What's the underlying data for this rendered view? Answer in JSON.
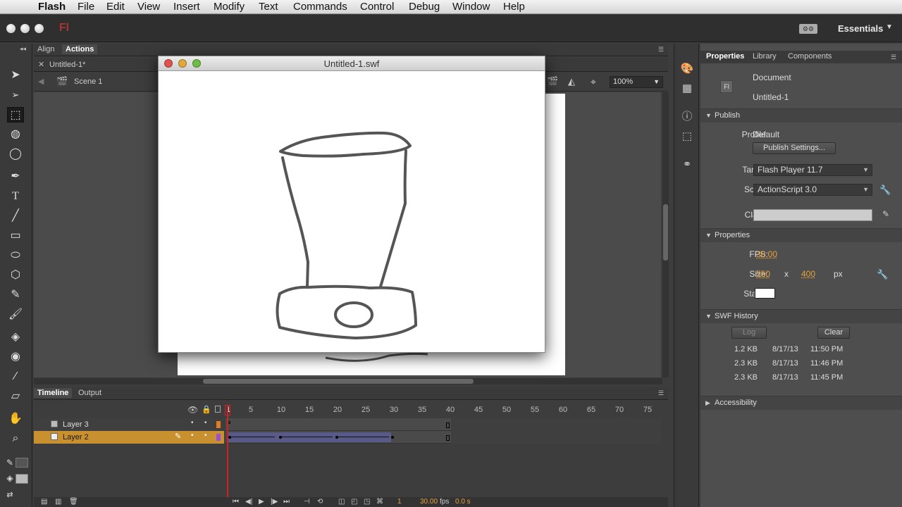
{
  "menubar": {
    "items": [
      "Flash",
      "File",
      "Edit",
      "View",
      "Insert",
      "Modify",
      "Text",
      "Commands",
      "Control",
      "Debug",
      "Window",
      "Help"
    ]
  },
  "appbar": {
    "app_icon_label": "Fl",
    "workspace": "Essentials"
  },
  "left_panel": {
    "tabs": [
      "Align",
      "Actions"
    ],
    "doc_tab": "Untitled-1*",
    "scene": "Scene 1",
    "zoom": "100%"
  },
  "swf_window": {
    "title": "Untitled-1.swf"
  },
  "timeline": {
    "tabs": [
      "Timeline",
      "Output"
    ],
    "ruler": [
      "1",
      "5",
      "10",
      "15",
      "20",
      "25",
      "30",
      "35",
      "40",
      "45",
      "50",
      "55",
      "60",
      "65",
      "70",
      "75"
    ],
    "layers": [
      {
        "name": "Layer 3"
      },
      {
        "name": "Layer 2"
      }
    ],
    "current_frame": "1",
    "fps": "30.00",
    "fps_unit": "fps",
    "time": "0.0 s"
  },
  "properties": {
    "tabs": [
      "Properties",
      "Library",
      "Components"
    ],
    "doc_icon": "Fl",
    "doc_type": "Document",
    "doc_name": "Untitled-1",
    "publish": {
      "title": "Publish",
      "profile_label": "Profile:",
      "profile_value": "Default",
      "settings_button": "Publish Settings...",
      "target_label": "Target:",
      "target_value": "Flash Player 11.7",
      "script_label": "Script:",
      "script_value": "ActionScript 3.0",
      "class_label": "Class:",
      "class_value": ""
    },
    "props": {
      "title": "Properties",
      "fps_label": "FPS:",
      "fps_value": "30.00",
      "size_label": "Size:",
      "width": "550",
      "x": "x",
      "height": "400",
      "unit": "px",
      "stage_label": "Stage:",
      "stage_color": "#ffffff"
    },
    "swf_history": {
      "title": "SWF History",
      "log_button": "Log",
      "clear_button": "Clear",
      "entries": [
        {
          "size": "1.2 KB",
          "date": "8/17/13",
          "time": "11:50 PM"
        },
        {
          "size": "2.3 KB",
          "date": "8/17/13",
          "time": "11:46 PM"
        },
        {
          "size": "2.3 KB",
          "date": "8/17/13",
          "time": "11:45 PM"
        }
      ]
    },
    "accessibility": {
      "title": "Accessibility"
    }
  }
}
